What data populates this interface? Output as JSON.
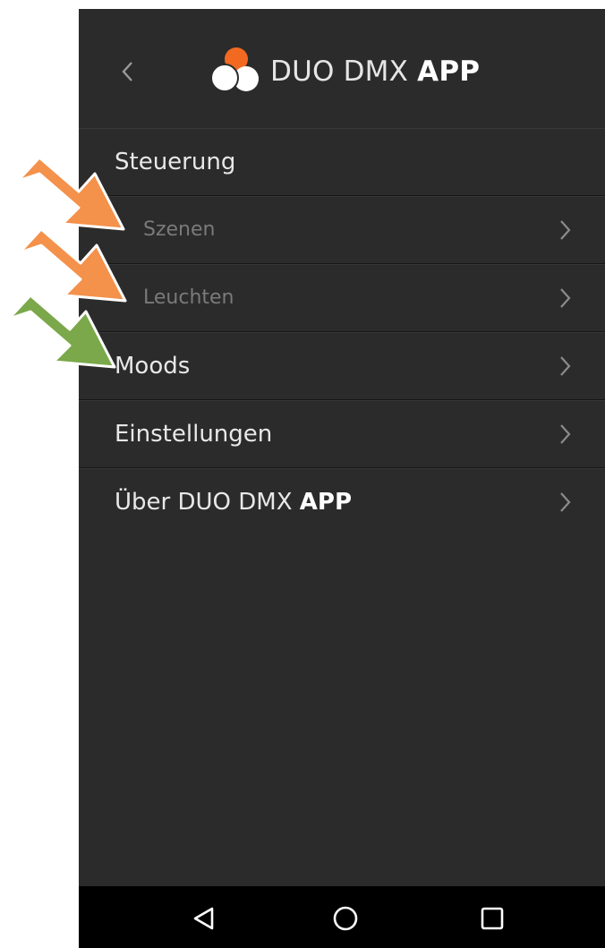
{
  "header": {
    "title_regular": "DUO DMX ",
    "title_bold": "APP",
    "back_icon": "chevron-left-icon",
    "logo_icon": "duo-dmx-logo",
    "logo_colors": {
      "top": "#f26a21",
      "left": "#ffffff",
      "right": "#ffffff"
    }
  },
  "menu": {
    "steuerung": "Steuerung",
    "szenen": "Szenen",
    "leuchten": "Leuchten",
    "moods": "Moods",
    "einstellungen": "Einstellungen",
    "ueber_regular": "Über DUO DMX ",
    "ueber_bold": "APP",
    "chevron_icon": "chevron-right-icon"
  },
  "navbar": {
    "back_icon": "triangle-back-icon",
    "home_icon": "circle-home-icon",
    "recents_icon": "square-recents-icon"
  },
  "annotations": {
    "orange_arrow_color": "#f4914b",
    "green_arrow_color": "#7aa84a",
    "arrow_outline_color": "#ffffff"
  }
}
